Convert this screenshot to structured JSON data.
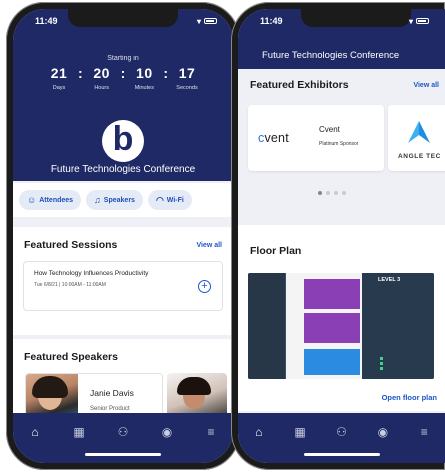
{
  "left_phone": {
    "status": {
      "time": "11:49"
    },
    "countdown": {
      "label": "Starting in",
      "units": [
        {
          "value": "21",
          "label": "Days"
        },
        {
          "value": "20",
          "label": "Hours"
        },
        {
          "value": "10",
          "label": "Minutes"
        },
        {
          "value": "17",
          "label": "Seconds"
        }
      ]
    },
    "logo_letter": "b",
    "conference_title": "Future Technologies Conference",
    "quick_links": [
      {
        "icon": "attendees-icon",
        "label": "Attendees"
      },
      {
        "icon": "speakers-icon",
        "label": "Speakers"
      },
      {
        "icon": "wifi-icon",
        "label": "Wi-Fi"
      }
    ],
    "featured_sessions": {
      "title": "Featured Sessions",
      "view_all": "View all",
      "sessions": [
        {
          "title": "How Technology Influences Productivity",
          "time": "Tue 6/8/21 | 10:00AM - 11:00AM"
        }
      ]
    },
    "featured_speakers": {
      "title": "Featured Speakers",
      "speakers": [
        {
          "name": "Janie Davis",
          "role": "Senior Product"
        }
      ]
    },
    "tabbar": [
      "home-icon",
      "calendar-icon",
      "people-icon",
      "profile-icon",
      "menu-icon"
    ]
  },
  "right_phone": {
    "status": {
      "time": "11:49"
    },
    "header_title": "Future Technologies Conference",
    "featured_exhibitors": {
      "title": "Featured Exhibitors",
      "view_all": "View all",
      "exhibitors": [
        {
          "logo_text": "cvent",
          "name": "Cvent",
          "tier": "Platinum Sponsor"
        },
        {
          "logo_text": "ANGLE TEC"
        }
      ],
      "carousel_dots": 4,
      "active_dot": 0
    },
    "floor_plan": {
      "title": "Floor Plan",
      "level_label": "LEVEL 3",
      "open_link": "Open floor plan"
    },
    "tabbar": [
      "home-icon",
      "calendar-icon",
      "people-icon",
      "profile-icon",
      "menu-icon"
    ]
  },
  "colors": {
    "brand_navy": "#1e2966",
    "link_blue": "#1e55c9",
    "chip_bg": "#e4ebf7",
    "booth_purple": "#8a3fb5",
    "booth_blue": "#2a8be0"
  }
}
